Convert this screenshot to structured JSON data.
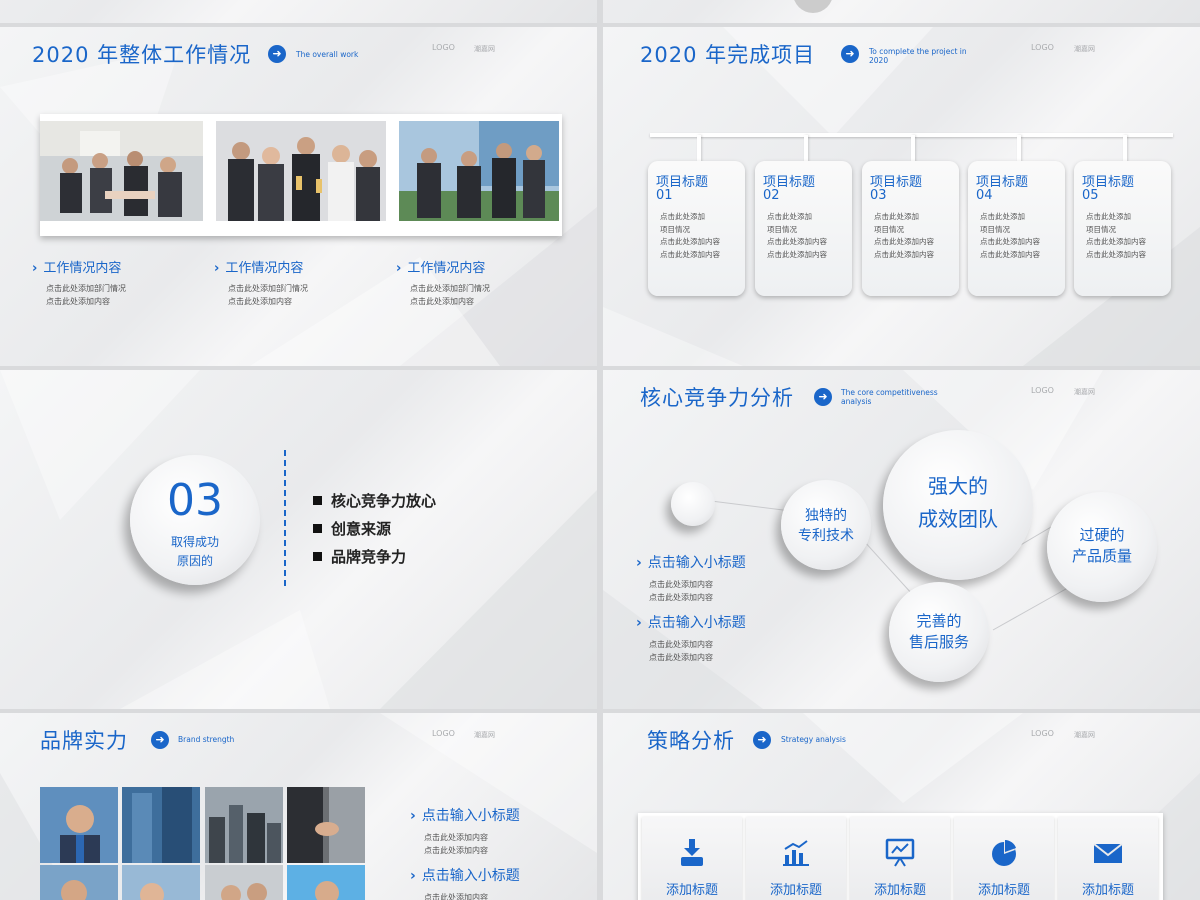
{
  "header_text": {
    "logo": "LOGO",
    "brand": "潮嘉网"
  },
  "slide1": {
    "title": "2020 年整体工作情况",
    "subtitle_en": "The overall work",
    "items": [
      {
        "heading": "工作情况内容",
        "line1": "点击此处添加部门情况",
        "line2": "点击此处添加内容"
      },
      {
        "heading": "工作情况内容",
        "line1": "点击此处添加部门情况",
        "line2": "点击此处添加内容"
      },
      {
        "heading": "工作情况内容",
        "line1": "点击此处添加部门情况",
        "line2": "点击此处添加内容"
      }
    ]
  },
  "slide2": {
    "title": "2020 年完成项目",
    "subtitle_en_1": "To complete the project in",
    "subtitle_en_2": "2020",
    "projects": [
      {
        "title": "项目标题",
        "num": "01",
        "l1": "点击此处添加",
        "l2": "项目情况",
        "l3": "点击此处添加内容",
        "l4": "点击此处添加内容"
      },
      {
        "title": "项目标题",
        "num": "02",
        "l1": "点击此处添加",
        "l2": "项目情况",
        "l3": "点击此处添加内容",
        "l4": "点击此处添加内容"
      },
      {
        "title": "项目标题",
        "num": "03",
        "l1": "点击此处添加",
        "l2": "项目情况",
        "l3": "点击此处添加内容",
        "l4": "点击此处添加内容"
      },
      {
        "title": "项目标题",
        "num": "04",
        "l1": "点击此处添加",
        "l2": "项目情况",
        "l3": "点击此处添加内容",
        "l4": "点击此处添加内容"
      },
      {
        "title": "项目标题",
        "num": "05",
        "l1": "点击此处添加",
        "l2": "项目情况",
        "l3": "点击此处添加内容",
        "l4": "点击此处添加内容"
      }
    ]
  },
  "slide3": {
    "number": "03",
    "sub1": "取得成功",
    "sub2": "原因的",
    "bullets": [
      "核心竞争力放心",
      "创意来源",
      "品牌竞争力"
    ]
  },
  "slide4": {
    "title": "核心竞争力分析",
    "subtitle_en_1": "The core competitiveness",
    "subtitle_en_2": "analysis",
    "bubbles": {
      "patent": [
        "独特的",
        "专利技术"
      ],
      "team": [
        "强大的",
        "成效团队"
      ],
      "quality": [
        "过硬的",
        "产品质量"
      ],
      "service": [
        "完善的",
        "售后服务"
      ]
    },
    "items": [
      {
        "heading": "点击输入小标题",
        "line1": "点击此处添加内容",
        "line2": "点击此处添加内容"
      },
      {
        "heading": "点击输入小标题",
        "line1": "点击此处添加内容",
        "line2": "点击此处添加内容"
      }
    ]
  },
  "slide5": {
    "title": "品牌实力",
    "subtitle_en": "Brand strength",
    "items": [
      {
        "heading": "点击输入小标题",
        "line1": "点击此处添加内容",
        "line2": "点击此处添加内容"
      },
      {
        "heading": "点击输入小标题",
        "line1": "点击此处添加内容"
      }
    ]
  },
  "slide6": {
    "title": "策略分析",
    "subtitle_en": "Strategy analysis",
    "cards": [
      {
        "label": "添加标题",
        "icon": "download-box-icon"
      },
      {
        "label": "添加标题",
        "icon": "bar-chart-icon"
      },
      {
        "label": "添加标题",
        "icon": "presentation-board-icon"
      },
      {
        "label": "添加标题",
        "icon": "pie-chart-icon"
      },
      {
        "label": "添加标题",
        "icon": "envelope-icon"
      }
    ]
  },
  "colors": {
    "accent": "#1a66c9",
    "background": "#ecedef",
    "text": "#333333"
  }
}
